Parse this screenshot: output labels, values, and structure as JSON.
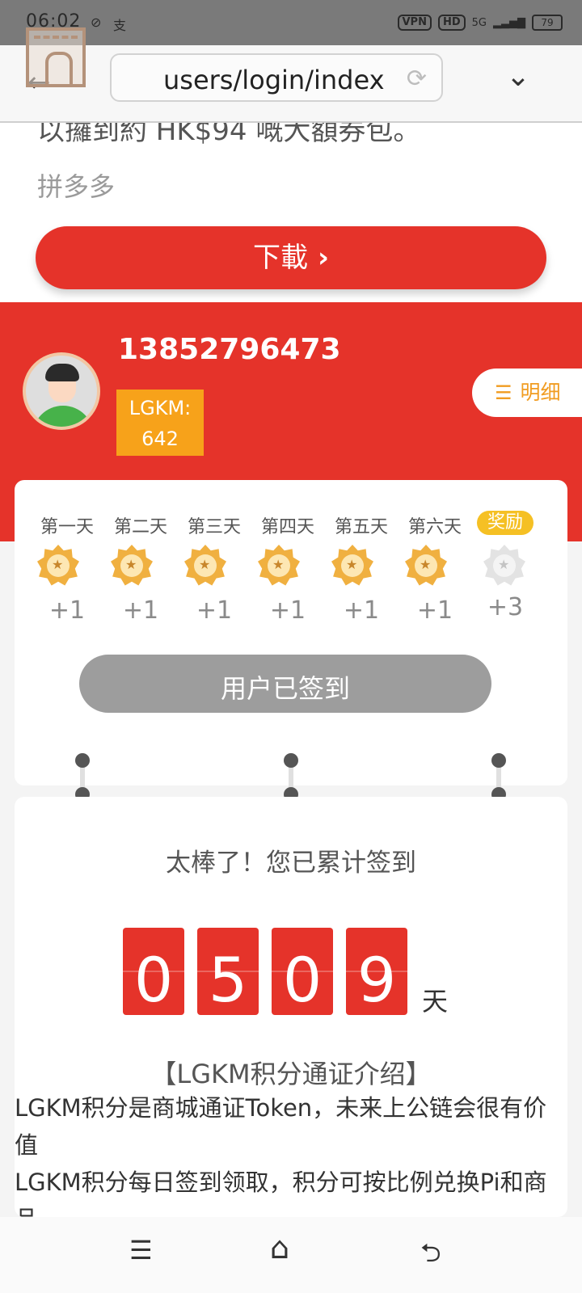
{
  "status_bar": {
    "time": "06:02",
    "vpn": "VPN",
    "hd": "HD",
    "network": "5G",
    "battery": "79"
  },
  "browser": {
    "url": "users/login/index"
  },
  "ad": {
    "cut_text": "以攞到約 HK$94 嘅大額券包。",
    "brand": "拼多多",
    "download_label": "下載"
  },
  "profile": {
    "phone": "13852796473",
    "points_label": "LGKM:",
    "points_value": "642",
    "detail_label": "明细"
  },
  "checkin": {
    "days": [
      {
        "label": "第一天",
        "points": "+1"
      },
      {
        "label": "第二天",
        "points": "+1"
      },
      {
        "label": "第三天",
        "points": "+1"
      },
      {
        "label": "第四天",
        "points": "+1"
      },
      {
        "label": "第五天",
        "points": "+1"
      },
      {
        "label": "第六天",
        "points": "+1"
      },
      {
        "label": "奖励",
        "points": "+3"
      }
    ],
    "signed_label": "用户已签到"
  },
  "total": {
    "message": "太棒了！您已累计签到",
    "digits": [
      "0",
      "5",
      "0",
      "9"
    ],
    "unit": "天"
  },
  "intro": {
    "title": "【LGKM积分通证介绍】",
    "line1": "LGKM积分是商城通证Token，未来上公链会很有价值",
    "line2": "LGKM积分每日签到领取，积分可按比例兑换Pi和商品"
  },
  "colors": {
    "primary_red": "#e5332a",
    "accent_orange": "#f7a21a",
    "signed_grey": "#9d9d9d"
  }
}
